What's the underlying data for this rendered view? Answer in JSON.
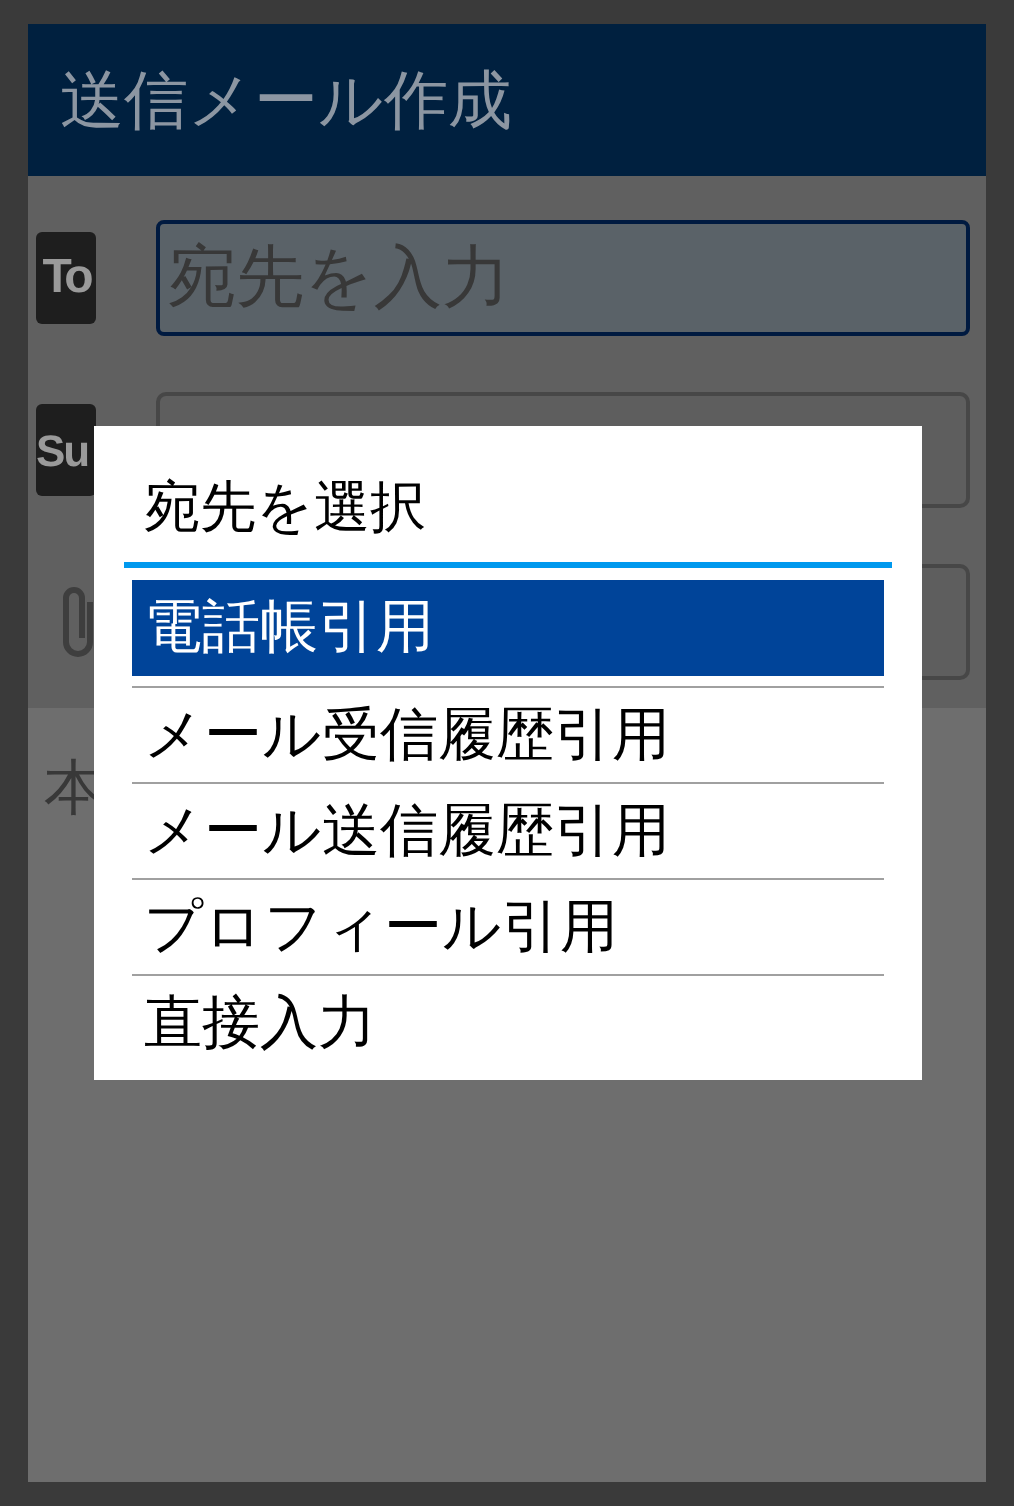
{
  "title": "送信メール作成",
  "to_row": {
    "badge": "To",
    "placeholder": "宛先を入力",
    "focused": true
  },
  "subject_row": {
    "badge": "Su"
  },
  "body_label": "本",
  "dialog": {
    "title": "宛先を選択",
    "items": [
      {
        "label": "電話帳引用",
        "selected": true
      },
      {
        "label": "メール受信履歴引用",
        "selected": false
      },
      {
        "label": "メール送信履歴引用",
        "selected": false
      },
      {
        "label": "プロフィール引用",
        "selected": false
      },
      {
        "label": "直接入力",
        "selected": false
      }
    ]
  }
}
